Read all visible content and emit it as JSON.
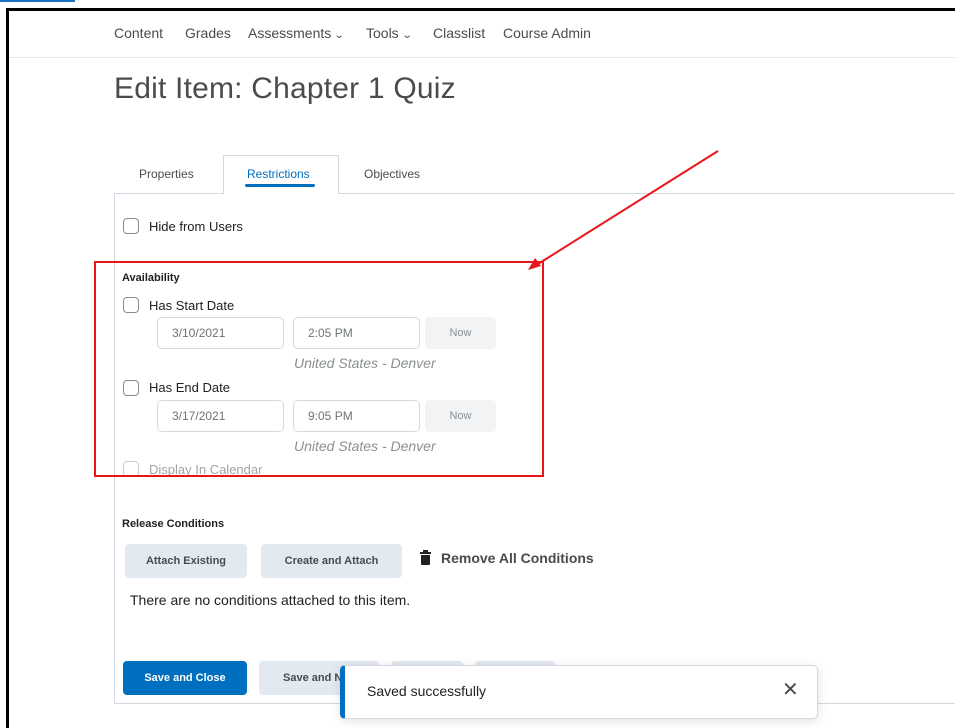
{
  "nav": {
    "items": [
      "Content",
      "Grades",
      "Assessments",
      "Tools",
      "Classlist",
      "Course Admin"
    ]
  },
  "page": {
    "title": "Edit Item: Chapter 1 Quiz"
  },
  "tabs": {
    "properties": "Properties",
    "restrictions": "Restrictions",
    "objectives": "Objectives",
    "active": "Restrictions"
  },
  "restrictions": {
    "hide_from_users": "Hide from Users",
    "availability_title": "Availability",
    "start": {
      "label": "Has Start Date",
      "date": "3/10/2021",
      "time": "2:05 PM",
      "now": "Now",
      "timezone": "United States - Denver"
    },
    "end": {
      "label": "Has End Date",
      "date": "3/17/2021",
      "time": "9:05 PM",
      "now": "Now",
      "timezone": "United States - Denver"
    },
    "display_in_calendar": "Display In Calendar"
  },
  "release": {
    "title": "Release Conditions",
    "attach_existing": "Attach Existing",
    "create_and_attach": "Create and Attach",
    "remove_all": "Remove All Conditions",
    "empty_text": "There are no conditions attached to this item."
  },
  "footer": {
    "save_close": "Save and Close",
    "save_new": "Save and N"
  },
  "toast": {
    "message": "Saved successfully"
  },
  "colors": {
    "primary": "#006fbf",
    "annotation": "#e8161b"
  }
}
